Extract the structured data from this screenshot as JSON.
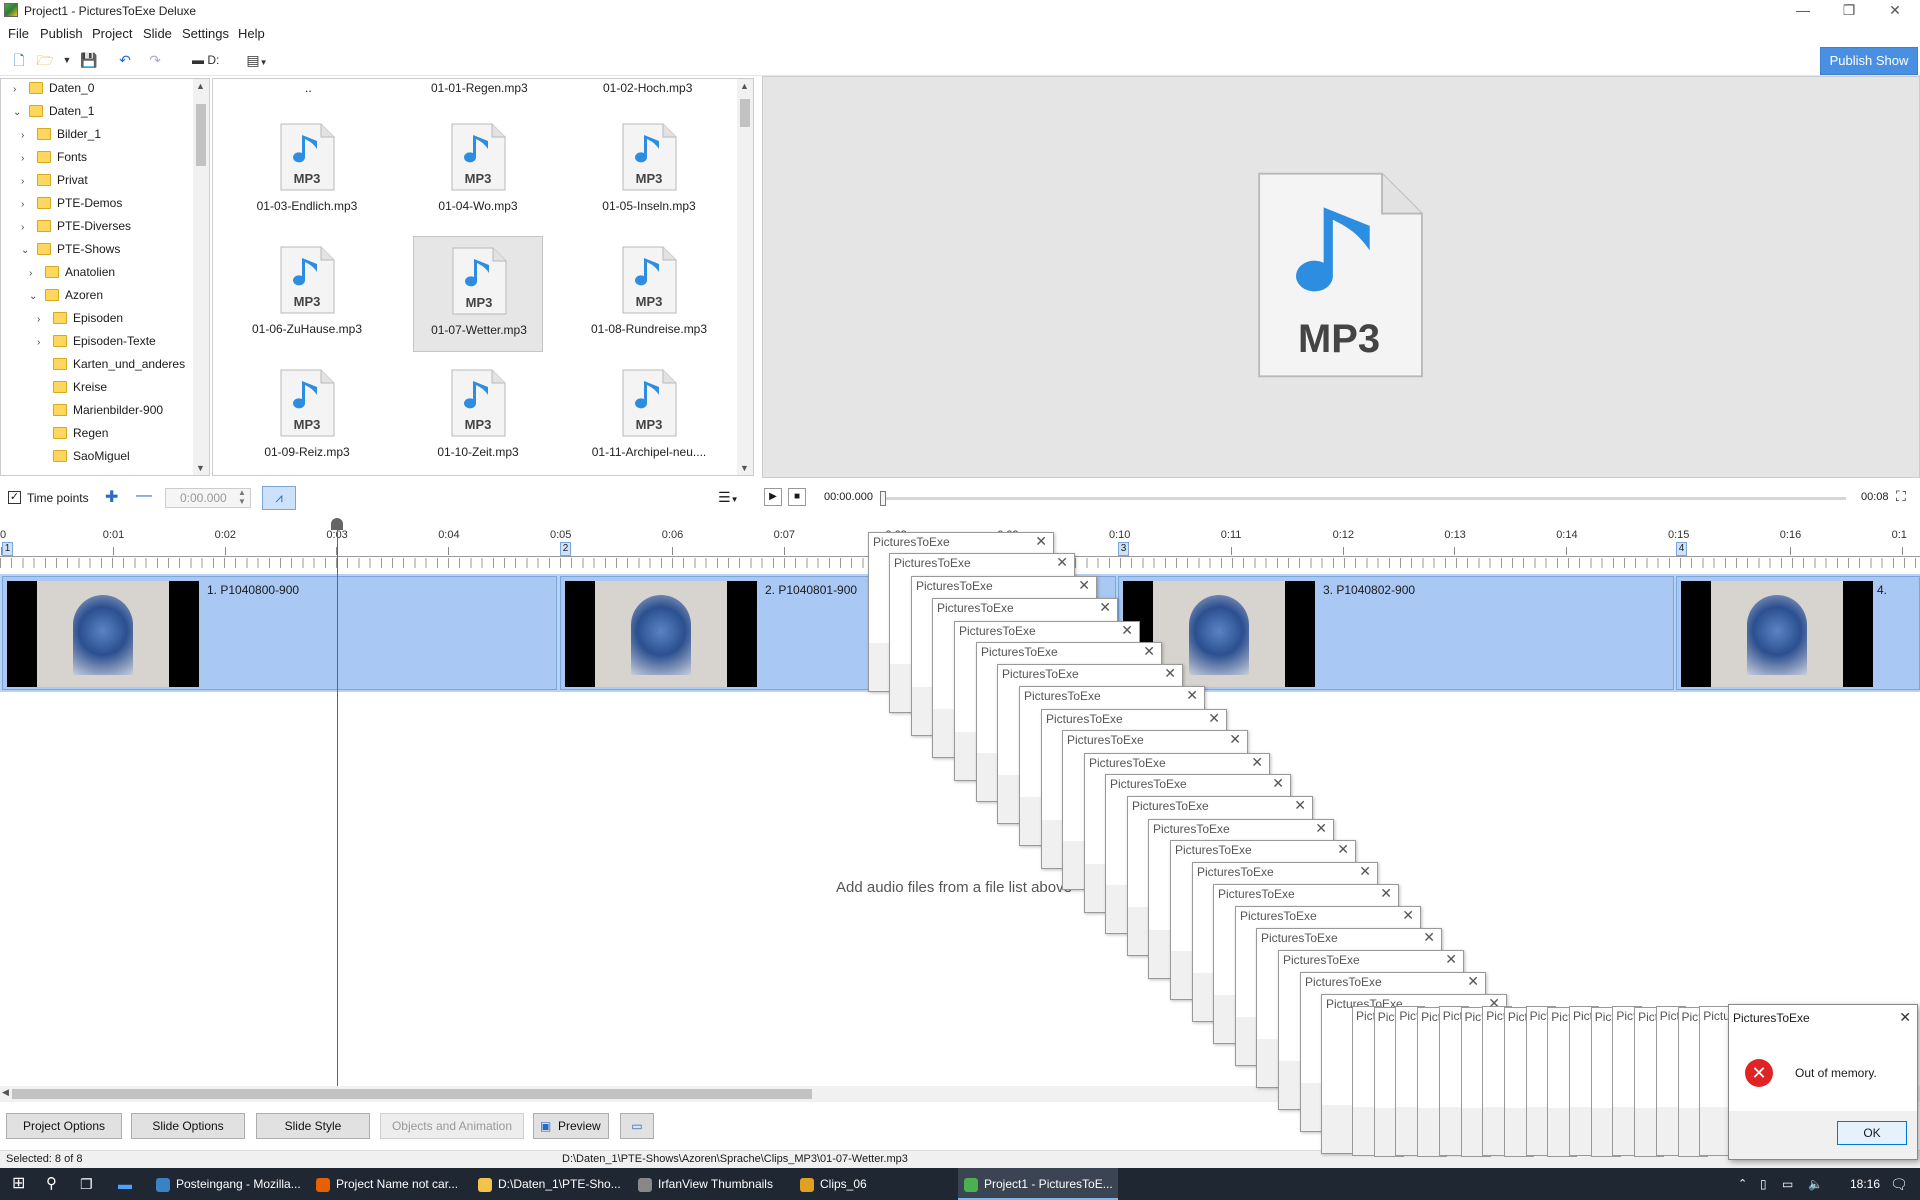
{
  "window": {
    "title": "Project1 - PicturesToExe Deluxe",
    "minimize": "—",
    "maximize": "❐",
    "close": "✕"
  },
  "menu": [
    "File",
    "Publish",
    "Project",
    "Slide",
    "Settings",
    "Help"
  ],
  "toolbar": {
    "drive_label": "D:",
    "publish_label": "Publish Show"
  },
  "tree": [
    {
      "label": "Daten_0",
      "depth": 0,
      "chev": "›"
    },
    {
      "label": "Daten_1",
      "depth": 0,
      "chev": "⌄"
    },
    {
      "label": "Bilder_1",
      "depth": 1,
      "chev": "›"
    },
    {
      "label": "Fonts",
      "depth": 1,
      "chev": "›"
    },
    {
      "label": "Privat",
      "depth": 1,
      "chev": "›"
    },
    {
      "label": "PTE-Demos",
      "depth": 1,
      "chev": "›"
    },
    {
      "label": "PTE-Diverses",
      "depth": 1,
      "chev": "›"
    },
    {
      "label": "PTE-Shows",
      "depth": 1,
      "chev": "⌄"
    },
    {
      "label": "Anatolien",
      "depth": 2,
      "chev": "›"
    },
    {
      "label": "Azoren",
      "depth": 2,
      "chev": "⌄"
    },
    {
      "label": "Episoden",
      "depth": 3,
      "chev": "›"
    },
    {
      "label": "Episoden-Texte",
      "depth": 3,
      "chev": "›"
    },
    {
      "label": "Karten_und_anderes",
      "depth": 3,
      "chev": ""
    },
    {
      "label": "Kreise",
      "depth": 3,
      "chev": ""
    },
    {
      "label": "Marienbilder-900",
      "depth": 3,
      "chev": ""
    },
    {
      "label": "Regen",
      "depth": 3,
      "chev": ""
    },
    {
      "label": "SaoMiguel",
      "depth": 3,
      "chev": ""
    }
  ],
  "files_top": [
    "..",
    "01-01-Regen.mp3",
    "01-02-Hoch.mp3"
  ],
  "files": [
    "01-03-Endlich.mp3",
    "01-04-Wo.mp3",
    "01-05-Inseln.mp3",
    "01-06-ZuHause.mp3",
    "01-07-Wetter.mp3",
    "01-08-Rundreise.mp3",
    "01-09-Reiz.mp3",
    "01-10-Zeit.mp3",
    "01-11-Archipel-neu...."
  ],
  "selected_file": "01-07-Wetter.mp3",
  "mp3_label": "MP3",
  "timeline": {
    "time_points_label": "Time points",
    "time_value": "0:00.000",
    "position": "00:00.000",
    "duration": "00:08",
    "ticks": [
      "0",
      "0:01",
      "0:02",
      "0:03",
      "0:04",
      "0:05",
      "0:06",
      "0:07",
      "0:08",
      "0:09",
      "0:10",
      "0:11",
      "0:12",
      "0:13",
      "0:14",
      "0:15",
      "0:16",
      "0:1"
    ],
    "slide_numbers": [
      "1",
      "2",
      "3",
      "4"
    ]
  },
  "slides": [
    "1. P1040800-900",
    "2. P1040801-900",
    "3. P1040802-900",
    "4."
  ],
  "audio_hint": "Add audio files from a file list above",
  "buttons": {
    "project_options": "Project Options",
    "slide_options": "Slide Options",
    "slide_style": "Slide Style",
    "objects_animation": "Objects and Animation",
    "preview": "Preview"
  },
  "status": {
    "selected": "Selected: 8 of 8",
    "path": "D:\\Daten_1\\PTE-Shows\\Azoren\\Sprache\\Clips_MP3\\01-07-Wetter.mp3"
  },
  "dialog_title": "PicturesToExe",
  "error": {
    "title": "PicturesToExe",
    "message": "Out of memory.",
    "ok": "OK"
  },
  "taskbar": {
    "items": [
      "Posteingang - Mozilla...",
      "Project Name not car...",
      "D:\\Daten_1\\PTE-Sho...",
      "IrfanView Thumbnails",
      "Clips_06",
      "Project1 - PicturesToE..."
    ],
    "clock": "18:16"
  }
}
